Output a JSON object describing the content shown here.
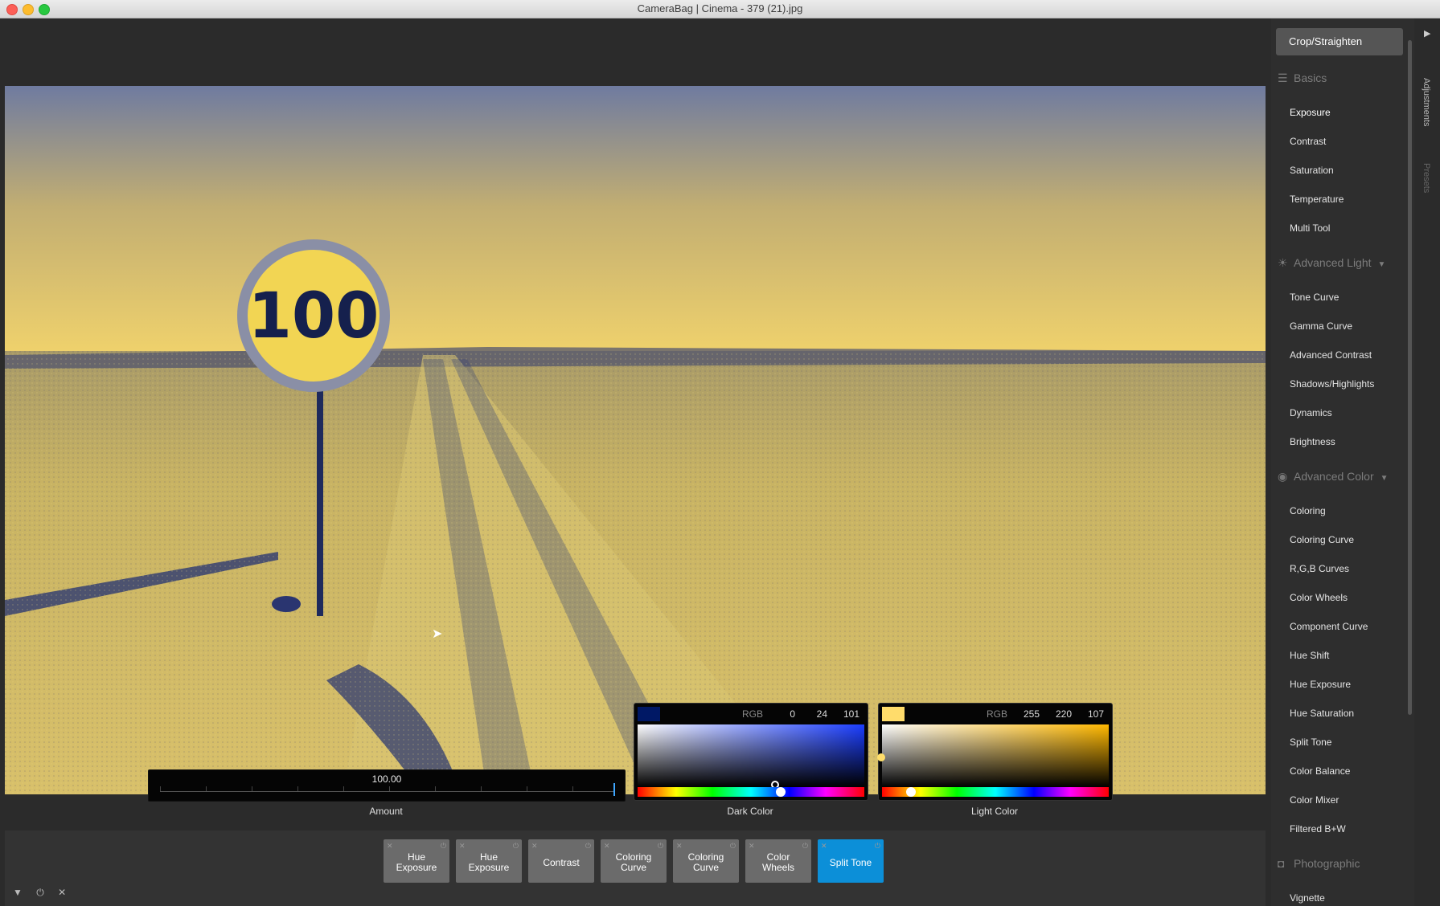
{
  "window": {
    "title": "CameraBag | Cinema - 379 (21).jpg"
  },
  "photo": {
    "sign_text": "100",
    "dark_tone": "#23367a",
    "light_tone": "#e8cd6b"
  },
  "amount": {
    "value": "100.00",
    "label": "Amount"
  },
  "dark_color": {
    "label": "Dark Color",
    "rgb_label": "RGB",
    "r": "0",
    "g": "24",
    "b": "101",
    "swatch": "#001865"
  },
  "light_color": {
    "label": "Light Color",
    "rgb_label": "RGB",
    "r": "255",
    "g": "220",
    "b": "107",
    "swatch": "#ffdc6b"
  },
  "adjustment_stack": [
    {
      "label_1": "Hue",
      "label_2": "Exposure"
    },
    {
      "label_1": "Hue",
      "label_2": "Exposure"
    },
    {
      "label_1": "Contrast",
      "label_2": ""
    },
    {
      "label_1": "Coloring",
      "label_2": "Curve"
    },
    {
      "label_1": "Coloring",
      "label_2": "Curve"
    },
    {
      "label_1": "Color",
      "label_2": "Wheels"
    },
    {
      "label_1": "Split Tone",
      "label_2": ""
    }
  ],
  "sidebar": {
    "crop_button": "Crop/Straighten",
    "sections": {
      "basics": "Basics",
      "advanced_light": "Advanced Light",
      "advanced_color": "Advanced Color",
      "photographic": "Photographic"
    },
    "basics_items": [
      "Exposure",
      "Contrast",
      "Saturation",
      "Temperature",
      "Multi Tool"
    ],
    "light_items": [
      "Tone Curve",
      "Gamma Curve",
      "Advanced Contrast",
      "Shadows/Highlights",
      "Dynamics",
      "Brightness"
    ],
    "color_items": [
      "Coloring",
      "Coloring Curve",
      "R,G,B Curves",
      "Color Wheels",
      "Component Curve",
      "Hue Shift",
      "Hue Exposure",
      "Hue Saturation",
      "Split Tone",
      "Color Balance",
      "Color Mixer",
      "Filtered B+W"
    ],
    "photo_items": [
      "Vignette"
    ]
  },
  "side_tabs": {
    "adjustments": "Adjustments",
    "presets": "Presets"
  },
  "accent_color": "#0c8fd8"
}
